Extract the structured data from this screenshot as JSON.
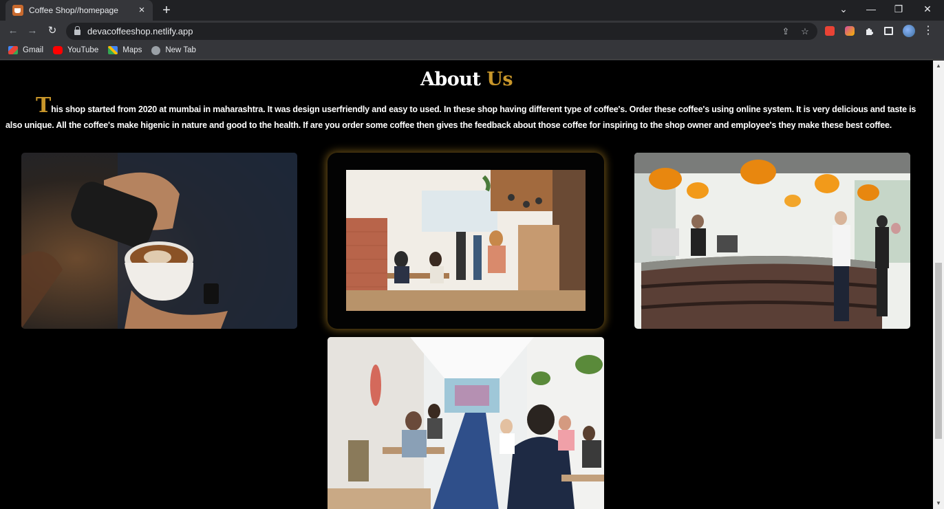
{
  "browser": {
    "tab_title": "Coffee Shop//homepage",
    "tab_close": "×",
    "new_tab": "+",
    "window_controls": {
      "collapse": "⌄",
      "minimize": "—",
      "restore": "❐",
      "close": "✕"
    },
    "nav": {
      "back": "←",
      "forward": "→",
      "reload": "↻"
    },
    "url": "devacoffeeshop.netlify.app",
    "omnibox_icons": {
      "share": "⇪",
      "star": "☆"
    },
    "menu": "⋮",
    "bookmarks": [
      {
        "label": "Gmail",
        "icon": "gmail-icon",
        "color": "#ea4335"
      },
      {
        "label": "YouTube",
        "icon": "youtube-icon",
        "color": "#ff0000"
      },
      {
        "label": "Maps",
        "icon": "maps-icon",
        "color": "#34a853"
      },
      {
        "label": "New Tab",
        "icon": "globe-icon",
        "color": "#9aa0a6"
      }
    ]
  },
  "about": {
    "heading_first": "About",
    "heading_accent": "Us",
    "dropcap": "T",
    "paragraph": "his shop started from 2020 at mumbai in maharashtra. It was design userfriendly and easy to used. In these shop having different type of coffee's. Order these coffee's using online system. It is very delicious and taste is also unique. All the coffee's make higenic in nature and good to the health. If are you order some coffee then gives the feedback about those coffee for inspiring to the shop owner and employee's they make these best coffee."
  },
  "gallery": [
    {
      "name": "latte-art-photo"
    },
    {
      "name": "cafe-interior-photo",
      "featured": true
    },
    {
      "name": "coffee-bar-counter-photo"
    },
    {
      "name": "busy-cafe-patio-photo"
    }
  ],
  "colors": {
    "accent": "#c8962a",
    "page_bg": "#000000",
    "chrome_dark": "#202124",
    "chrome_light": "#35363a"
  }
}
